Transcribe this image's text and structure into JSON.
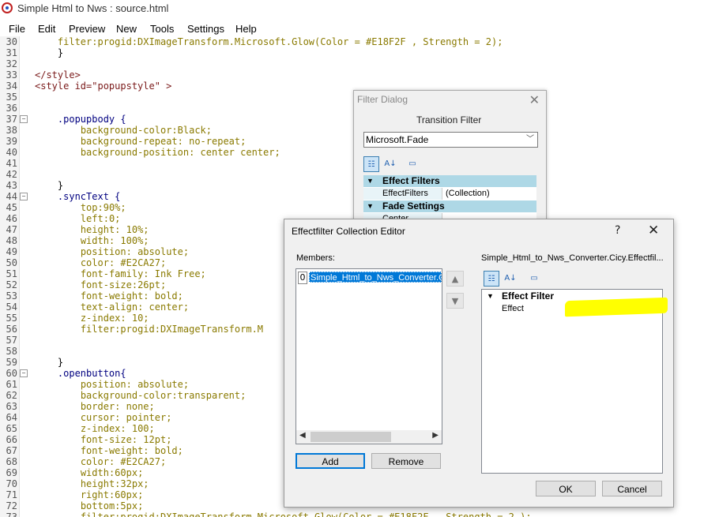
{
  "window": {
    "title": "Simple Html to Nws : source.html"
  },
  "menu": [
    "File",
    "Edit",
    "Preview",
    "New",
    "Tools",
    "Settings",
    "Help"
  ],
  "code_lines": [
    {
      "n": "30",
      "fold": "",
      "text": "filter:progid:DXImageTransform.Microsoft.Glow(Color = #E18F2F , Strength = 2);",
      "indent": 4
    },
    {
      "n": "31",
      "fold": "",
      "text": "}",
      "indent": 4
    },
    {
      "n": "32",
      "fold": "",
      "text": "",
      "indent": 0
    },
    {
      "n": "33",
      "fold": "",
      "text": "</style>",
      "indent": 0
    },
    {
      "n": "34",
      "fold": "",
      "text": "<style id=\"popupstyle\" >",
      "indent": 0
    },
    {
      "n": "35",
      "fold": "",
      "text": "",
      "indent": 0
    },
    {
      "n": "36",
      "fold": "",
      "text": "",
      "indent": 0
    },
    {
      "n": "37",
      "fold": "-",
      "text": ".popupbody {",
      "indent": 4
    },
    {
      "n": "38",
      "fold": "",
      "text": "background-color:Black;",
      "indent": 8
    },
    {
      "n": "39",
      "fold": "",
      "text": "background-repeat: no-repeat;",
      "indent": 8
    },
    {
      "n": "40",
      "fold": "",
      "text": "background-position: center center;",
      "indent": 8
    },
    {
      "n": "41",
      "fold": "",
      "text": "",
      "indent": 0
    },
    {
      "n": "42",
      "fold": "",
      "text": "",
      "indent": 0
    },
    {
      "n": "43",
      "fold": "",
      "text": "}",
      "indent": 4
    },
    {
      "n": "44",
      "fold": "-",
      "text": ".syncText {",
      "indent": 4
    },
    {
      "n": "45",
      "fold": "",
      "text": "top:90%;",
      "indent": 8
    },
    {
      "n": "46",
      "fold": "",
      "text": "left:0;",
      "indent": 8
    },
    {
      "n": "47",
      "fold": "",
      "text": "height: 10%;",
      "indent": 8
    },
    {
      "n": "48",
      "fold": "",
      "text": "width: 100%;",
      "indent": 8
    },
    {
      "n": "49",
      "fold": "",
      "text": "position: absolute;",
      "indent": 8
    },
    {
      "n": "50",
      "fold": "",
      "text": "color: #E2CA27;",
      "indent": 8
    },
    {
      "n": "51",
      "fold": "",
      "text": "font-family: Ink Free;",
      "indent": 8
    },
    {
      "n": "52",
      "fold": "",
      "text": "font-size:26pt;",
      "indent": 8
    },
    {
      "n": "53",
      "fold": "",
      "text": "font-weight: bold;",
      "indent": 8
    },
    {
      "n": "54",
      "fold": "",
      "text": "text-align: center;",
      "indent": 8
    },
    {
      "n": "55",
      "fold": "",
      "text": "z-index: 10;",
      "indent": 8
    },
    {
      "n": "56",
      "fold": "",
      "text": "filter:progid:DXImageTransform.M",
      "indent": 8
    },
    {
      "n": "57",
      "fold": "",
      "text": "",
      "indent": 0
    },
    {
      "n": "58",
      "fold": "",
      "text": "",
      "indent": 0
    },
    {
      "n": "59",
      "fold": "",
      "text": "}",
      "indent": 4
    },
    {
      "n": "60",
      "fold": "-",
      "text": ".openbutton{",
      "indent": 4
    },
    {
      "n": "61",
      "fold": "",
      "text": "position: absolute;",
      "indent": 8
    },
    {
      "n": "62",
      "fold": "",
      "text": "background-color:transparent;",
      "indent": 8
    },
    {
      "n": "63",
      "fold": "",
      "text": "border: none;",
      "indent": 8
    },
    {
      "n": "64",
      "fold": "",
      "text": "cursor: pointer;",
      "indent": 8
    },
    {
      "n": "65",
      "fold": "",
      "text": "z-index: 100;",
      "indent": 8
    },
    {
      "n": "66",
      "fold": "",
      "text": "font-size: 12pt;",
      "indent": 8
    },
    {
      "n": "67",
      "fold": "",
      "text": "font-weight: bold;",
      "indent": 8
    },
    {
      "n": "68",
      "fold": "",
      "text": "color: #E2CA27;",
      "indent": 8
    },
    {
      "n": "69",
      "fold": "",
      "text": "width:60px;",
      "indent": 8
    },
    {
      "n": "70",
      "fold": "",
      "text": "height:32px;",
      "indent": 8
    },
    {
      "n": "71",
      "fold": "",
      "text": "right:60px;",
      "indent": 8
    },
    {
      "n": "72",
      "fold": "",
      "text": "bottom:5px;",
      "indent": 8
    },
    {
      "n": "73",
      "fold": "",
      "text": "filter:progid:DXImageTransform.Microsoft.Glow(Color = #E18F2F , Strength = 2 );",
      "indent": 8
    }
  ],
  "filter_dialog": {
    "title": "Filter Dialog",
    "transition_label": "Transition Filter",
    "selected_filter": "Microsoft.Fade",
    "grid": {
      "cat1": "Effect Filters",
      "row1_key": "EffectFilters",
      "row1_val": "(Collection)",
      "cat2": "Fade Settings",
      "row2_key": "Center"
    }
  },
  "collection_editor": {
    "title": "Effectfilter Collection Editor",
    "help": "?",
    "members_label": "Members:",
    "member_index": "0",
    "member_item": "Simple_Html_to_Nws_Converter.Cicy.Effectfilter",
    "object_title": "Simple_Html_to_Nws_Converter.Cicy.Effectfil...",
    "category": "Effect Filter",
    "property": "Effect",
    "add": "Add",
    "remove": "Remove",
    "ok": "OK",
    "cancel": "Cancel"
  },
  "colors": {
    "highlight": "#ffff00",
    "category_bg": "#aed8e6",
    "selection": "#0078d7"
  }
}
